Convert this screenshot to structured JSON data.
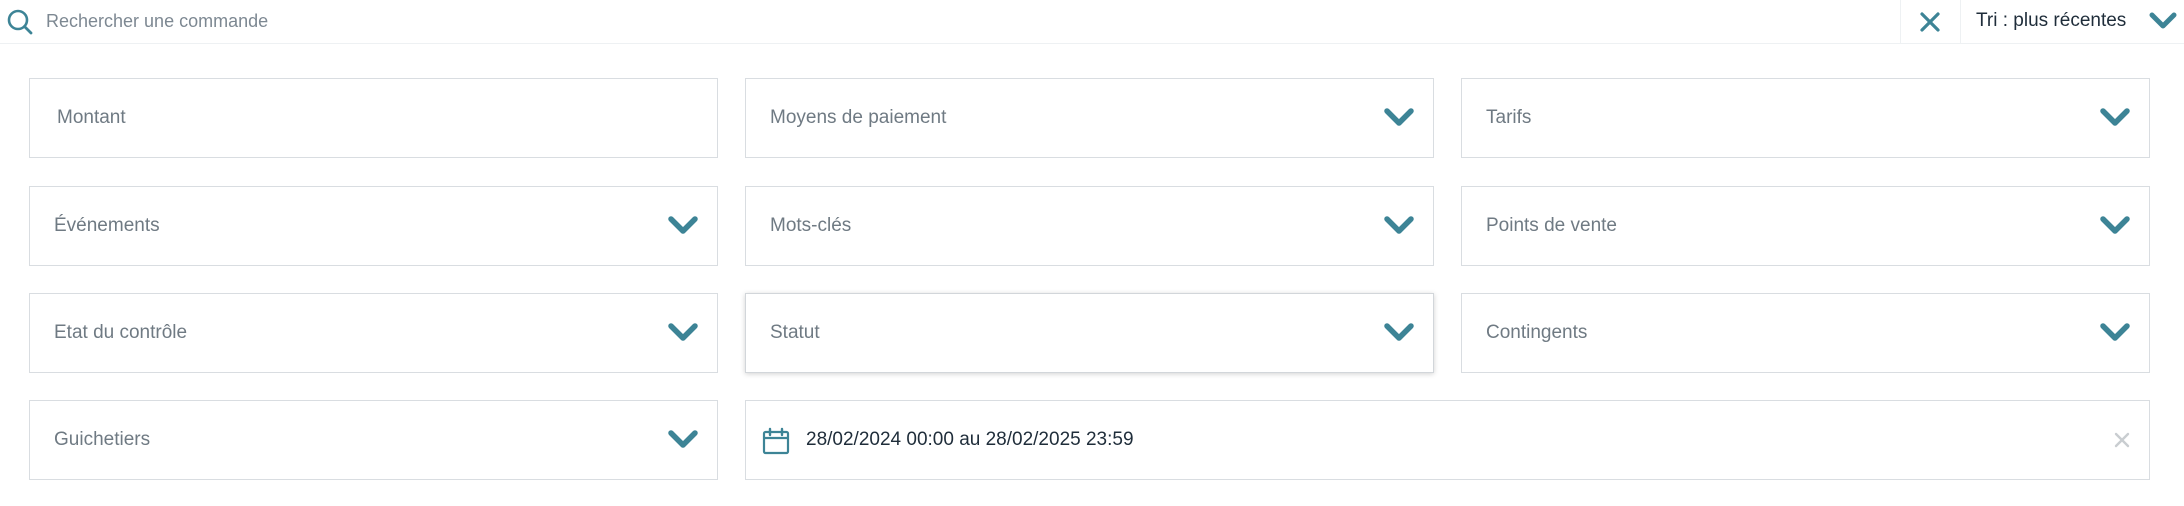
{
  "colors": {
    "accent": "#3d8496",
    "border": "#d9dde1",
    "text_muted": "#6f7a83",
    "text_dark": "#1f2d3a",
    "clear_light": "#c9cdd1"
  },
  "search": {
    "placeholder": "Rechercher une commande",
    "value": "",
    "icon": "search-icon",
    "clear_icon": "close-icon"
  },
  "sort": {
    "label": "Tri : plus récentes",
    "icon": "chevron-down-icon"
  },
  "filters": {
    "montant": {
      "placeholder": "Montant",
      "value": ""
    },
    "moyens_paiement": {
      "label": "Moyens de paiement"
    },
    "tarifs": {
      "label": "Tarifs"
    },
    "evenements": {
      "label": "Événements"
    },
    "mots_cles": {
      "label": "Mots-clés"
    },
    "points_vente": {
      "label": "Points de vente"
    },
    "etat_controle": {
      "label": "Etat du contrôle"
    },
    "statut": {
      "label": "Statut"
    },
    "contingents": {
      "label": "Contingents"
    },
    "guichetiers": {
      "label": "Guichetiers"
    },
    "date_range": {
      "value": "28/02/2024 00:00 au 28/02/2025 23:59",
      "icon": "calendar-icon",
      "clear_icon": "close-icon"
    }
  }
}
